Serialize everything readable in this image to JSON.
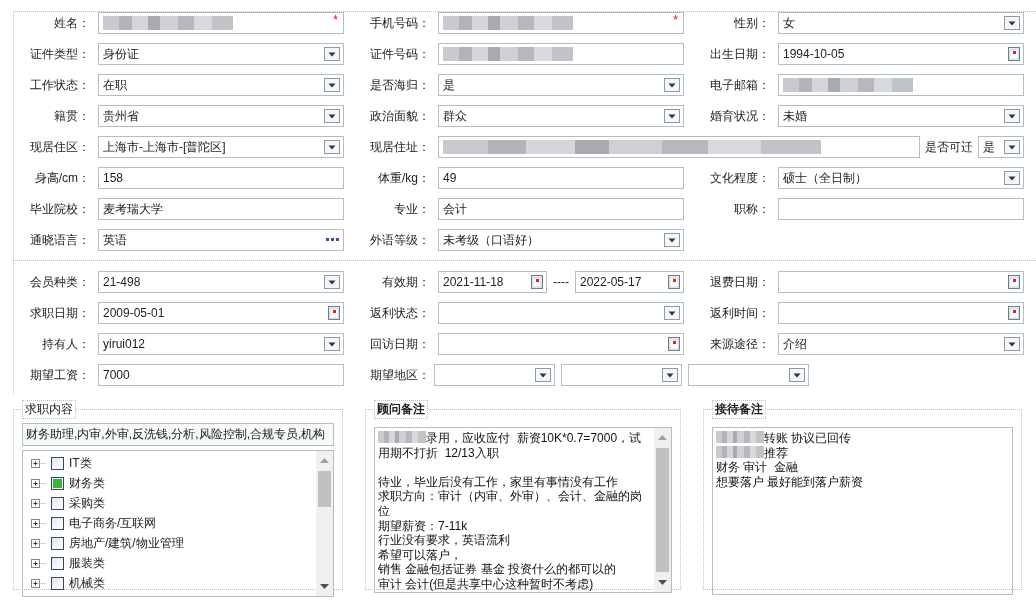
{
  "personal": {
    "rows": [
      [
        {
          "label": "姓名：",
          "kind": "redacted",
          "required_mark": "*"
        },
        {
          "label": "手机号码：",
          "kind": "redacted",
          "required_mark": "*"
        },
        {
          "label": "性别：",
          "kind": "select",
          "value": "女"
        }
      ],
      [
        {
          "label": "证件类型：",
          "kind": "select",
          "value": "身份证"
        },
        {
          "label": "证件号码：",
          "kind": "redacted"
        },
        {
          "label": "出生日期：",
          "kind": "date",
          "value": "1994-10-05"
        }
      ],
      [
        {
          "label": "工作状态：",
          "kind": "select",
          "value": "在职"
        },
        {
          "label": "是否海归：",
          "kind": "select",
          "value": "是"
        },
        {
          "label": "电子邮箱：",
          "kind": "redacted"
        }
      ],
      [
        {
          "label": "籍贯：",
          "kind": "select",
          "value": "贵州省"
        },
        {
          "label": "政治面貌：",
          "kind": "select",
          "value": "群众"
        },
        {
          "label": "婚育状况：",
          "kind": "select",
          "value": "未婚"
        }
      ],
      [
        {
          "label": "现居住区：",
          "kind": "select",
          "value": "上海市-上海市-[普陀区]"
        },
        {
          "label": "现居住址：",
          "kind": "redacted",
          "attached": {
            "label": "是否可迁",
            "kind": "select",
            "value": "是"
          }
        }
      ],
      [
        {
          "label": "身高/cm：",
          "kind": "text",
          "value": "158"
        },
        {
          "label": "体重/kg：",
          "kind": "text",
          "value": "49"
        },
        {
          "label": "文化程度：",
          "kind": "select",
          "value": "硕士（全日制）"
        }
      ],
      [
        {
          "label": "毕业院校：",
          "kind": "text",
          "value": "麦考瑞大学"
        },
        {
          "label": "专业：",
          "kind": "text",
          "value": "会计"
        },
        {
          "label": "职称：",
          "kind": "text"
        }
      ],
      [
        {
          "label": "通晓语言：",
          "kind": "picker",
          "value": "英语"
        },
        {
          "label": "外语等级：",
          "kind": "select",
          "value": "未考级（口语好）"
        }
      ]
    ]
  },
  "membership": {
    "rows": [
      [
        {
          "label": "会员种类：",
          "kind": "select",
          "value": "21-498"
        },
        {
          "label": "有效期：",
          "kind": "date-range",
          "from": "2021-11-18",
          "separator": "----",
          "to": "2022-05-17"
        },
        {
          "label": "退费日期：",
          "kind": "date"
        }
      ],
      [
        {
          "label": "求职日期：",
          "kind": "date",
          "value": "2009-05-01"
        },
        {
          "label": "返利状态：",
          "kind": "select"
        },
        {
          "label": "返利时间：",
          "kind": "date"
        }
      ],
      [
        {
          "label": "持有人：",
          "kind": "select",
          "value": "yirui012"
        },
        {
          "label": "回访日期：",
          "kind": "date"
        },
        {
          "label": "来源途径：",
          "kind": "select",
          "value": "介绍"
        }
      ],
      [
        {
          "label": "期望工资：",
          "kind": "text",
          "value": "7000"
        },
        {
          "label": "期望地区：",
          "kind": "select-group",
          "selects": [
            {
              "kind": "select"
            },
            {
              "kind": "select"
            },
            {
              "kind": "select"
            }
          ]
        }
      ]
    ]
  },
  "job_content": {
    "legend": "求职内容",
    "emphasized": false,
    "summary": "财务助理,内审,外审,反洗钱,分析,风险控制,合规专员,机构",
    "tree": [
      {
        "label": "IT类",
        "expanded": false,
        "checked": false
      },
      {
        "label": "财务类",
        "expanded": false,
        "checked": true
      },
      {
        "label": "采购类",
        "expanded": false,
        "checked": false
      },
      {
        "label": "电子商务/互联网",
        "expanded": false,
        "checked": false
      },
      {
        "label": "房地产/建筑/物业管理",
        "expanded": false,
        "checked": false
      },
      {
        "label": "服装类",
        "expanded": false,
        "checked": false
      },
      {
        "label": "机械类",
        "expanded": false,
        "checked": false
      }
    ]
  },
  "consultant_notes": {
    "legend": "顾问备注",
    "emphasized": true,
    "paragraphs": [
      {
        "lines": [
          {
            "text": "录用，应收应付  薪资10K*0.7=7000，试",
            "redacted": true
          },
          {
            "text": "用期不打折  12/13入职",
            "redacted": false
          }
        ]
      },
      {
        "lines": [
          {
            "text": "待业，毕业后没有工作，家里有事情没有工作",
            "redacted": false
          },
          {
            "text": "求职方向：审计（内审、外审）、会计、金融的岗位",
            "redacted": false
          },
          {
            "text": "期望薪资：7-11k",
            "redacted": false
          },
          {
            "text": "行业没有要求，英语流利",
            "redacted": false
          },
          {
            "text": "希望可以落户，",
            "redacted": false
          },
          {
            "text": "销售 金融包括证券 基金 投资什么的都可以的",
            "redacted": false
          },
          {
            "text": "审计 会计(但是共享中心这种暂时不考虑)",
            "redacted": false
          }
        ]
      }
    ]
  },
  "reception_notes": {
    "legend": "接待备注",
    "emphasized": true,
    "paragraphs": [
      {
        "lines": [
          {
            "text": "转账 协议已回传",
            "redacted": true
          },
          {
            "text": "推荐",
            "redacted": true
          },
          {
            "text": "财务 审计  金融",
            "redacted": false
          },
          {
            "text": "想要落户 最好能到落户薪资",
            "redacted": false
          }
        ]
      }
    ]
  }
}
